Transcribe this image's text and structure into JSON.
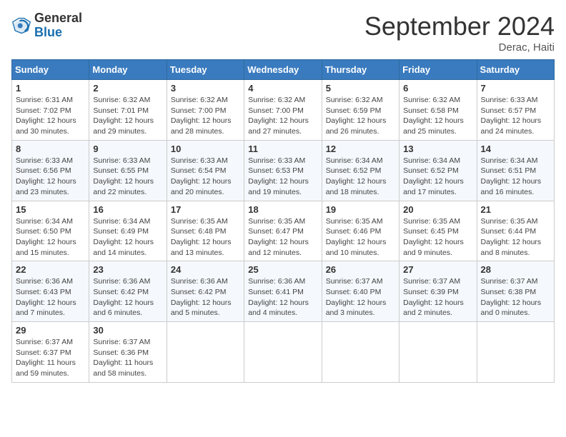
{
  "header": {
    "logo_line1": "General",
    "logo_line2": "Blue",
    "month_title": "September 2024",
    "location": "Derac, Haiti"
  },
  "weekdays": [
    "Sunday",
    "Monday",
    "Tuesday",
    "Wednesday",
    "Thursday",
    "Friday",
    "Saturday"
  ],
  "weeks": [
    [
      {
        "day": 1,
        "sunrise": "6:31 AM",
        "sunset": "7:02 PM",
        "daylight": "12 hours and 30 minutes."
      },
      {
        "day": 2,
        "sunrise": "6:32 AM",
        "sunset": "7:01 PM",
        "daylight": "12 hours and 29 minutes."
      },
      {
        "day": 3,
        "sunrise": "6:32 AM",
        "sunset": "7:00 PM",
        "daylight": "12 hours and 28 minutes."
      },
      {
        "day": 4,
        "sunrise": "6:32 AM",
        "sunset": "7:00 PM",
        "daylight": "12 hours and 27 minutes."
      },
      {
        "day": 5,
        "sunrise": "6:32 AM",
        "sunset": "6:59 PM",
        "daylight": "12 hours and 26 minutes."
      },
      {
        "day": 6,
        "sunrise": "6:32 AM",
        "sunset": "6:58 PM",
        "daylight": "12 hours and 25 minutes."
      },
      {
        "day": 7,
        "sunrise": "6:33 AM",
        "sunset": "6:57 PM",
        "daylight": "12 hours and 24 minutes."
      }
    ],
    [
      {
        "day": 8,
        "sunrise": "6:33 AM",
        "sunset": "6:56 PM",
        "daylight": "12 hours and 23 minutes."
      },
      {
        "day": 9,
        "sunrise": "6:33 AM",
        "sunset": "6:55 PM",
        "daylight": "12 hours and 22 minutes."
      },
      {
        "day": 10,
        "sunrise": "6:33 AM",
        "sunset": "6:54 PM",
        "daylight": "12 hours and 20 minutes."
      },
      {
        "day": 11,
        "sunrise": "6:33 AM",
        "sunset": "6:53 PM",
        "daylight": "12 hours and 19 minutes."
      },
      {
        "day": 12,
        "sunrise": "6:34 AM",
        "sunset": "6:52 PM",
        "daylight": "12 hours and 18 minutes."
      },
      {
        "day": 13,
        "sunrise": "6:34 AM",
        "sunset": "6:52 PM",
        "daylight": "12 hours and 17 minutes."
      },
      {
        "day": 14,
        "sunrise": "6:34 AM",
        "sunset": "6:51 PM",
        "daylight": "12 hours and 16 minutes."
      }
    ],
    [
      {
        "day": 15,
        "sunrise": "6:34 AM",
        "sunset": "6:50 PM",
        "daylight": "12 hours and 15 minutes."
      },
      {
        "day": 16,
        "sunrise": "6:34 AM",
        "sunset": "6:49 PM",
        "daylight": "12 hours and 14 minutes."
      },
      {
        "day": 17,
        "sunrise": "6:35 AM",
        "sunset": "6:48 PM",
        "daylight": "12 hours and 13 minutes."
      },
      {
        "day": 18,
        "sunrise": "6:35 AM",
        "sunset": "6:47 PM",
        "daylight": "12 hours and 12 minutes."
      },
      {
        "day": 19,
        "sunrise": "6:35 AM",
        "sunset": "6:46 PM",
        "daylight": "12 hours and 10 minutes."
      },
      {
        "day": 20,
        "sunrise": "6:35 AM",
        "sunset": "6:45 PM",
        "daylight": "12 hours and 9 minutes."
      },
      {
        "day": 21,
        "sunrise": "6:35 AM",
        "sunset": "6:44 PM",
        "daylight": "12 hours and 8 minutes."
      }
    ],
    [
      {
        "day": 22,
        "sunrise": "6:36 AM",
        "sunset": "6:43 PM",
        "daylight": "12 hours and 7 minutes."
      },
      {
        "day": 23,
        "sunrise": "6:36 AM",
        "sunset": "6:42 PM",
        "daylight": "12 hours and 6 minutes."
      },
      {
        "day": 24,
        "sunrise": "6:36 AM",
        "sunset": "6:42 PM",
        "daylight": "12 hours and 5 minutes."
      },
      {
        "day": 25,
        "sunrise": "6:36 AM",
        "sunset": "6:41 PM",
        "daylight": "12 hours and 4 minutes."
      },
      {
        "day": 26,
        "sunrise": "6:37 AM",
        "sunset": "6:40 PM",
        "daylight": "12 hours and 3 minutes."
      },
      {
        "day": 27,
        "sunrise": "6:37 AM",
        "sunset": "6:39 PM",
        "daylight": "12 hours and 2 minutes."
      },
      {
        "day": 28,
        "sunrise": "6:37 AM",
        "sunset": "6:38 PM",
        "daylight": "12 hours and 0 minutes."
      }
    ],
    [
      {
        "day": 29,
        "sunrise": "6:37 AM",
        "sunset": "6:37 PM",
        "daylight": "11 hours and 59 minutes."
      },
      {
        "day": 30,
        "sunrise": "6:37 AM",
        "sunset": "6:36 PM",
        "daylight": "11 hours and 58 minutes."
      },
      null,
      null,
      null,
      null,
      null
    ]
  ]
}
